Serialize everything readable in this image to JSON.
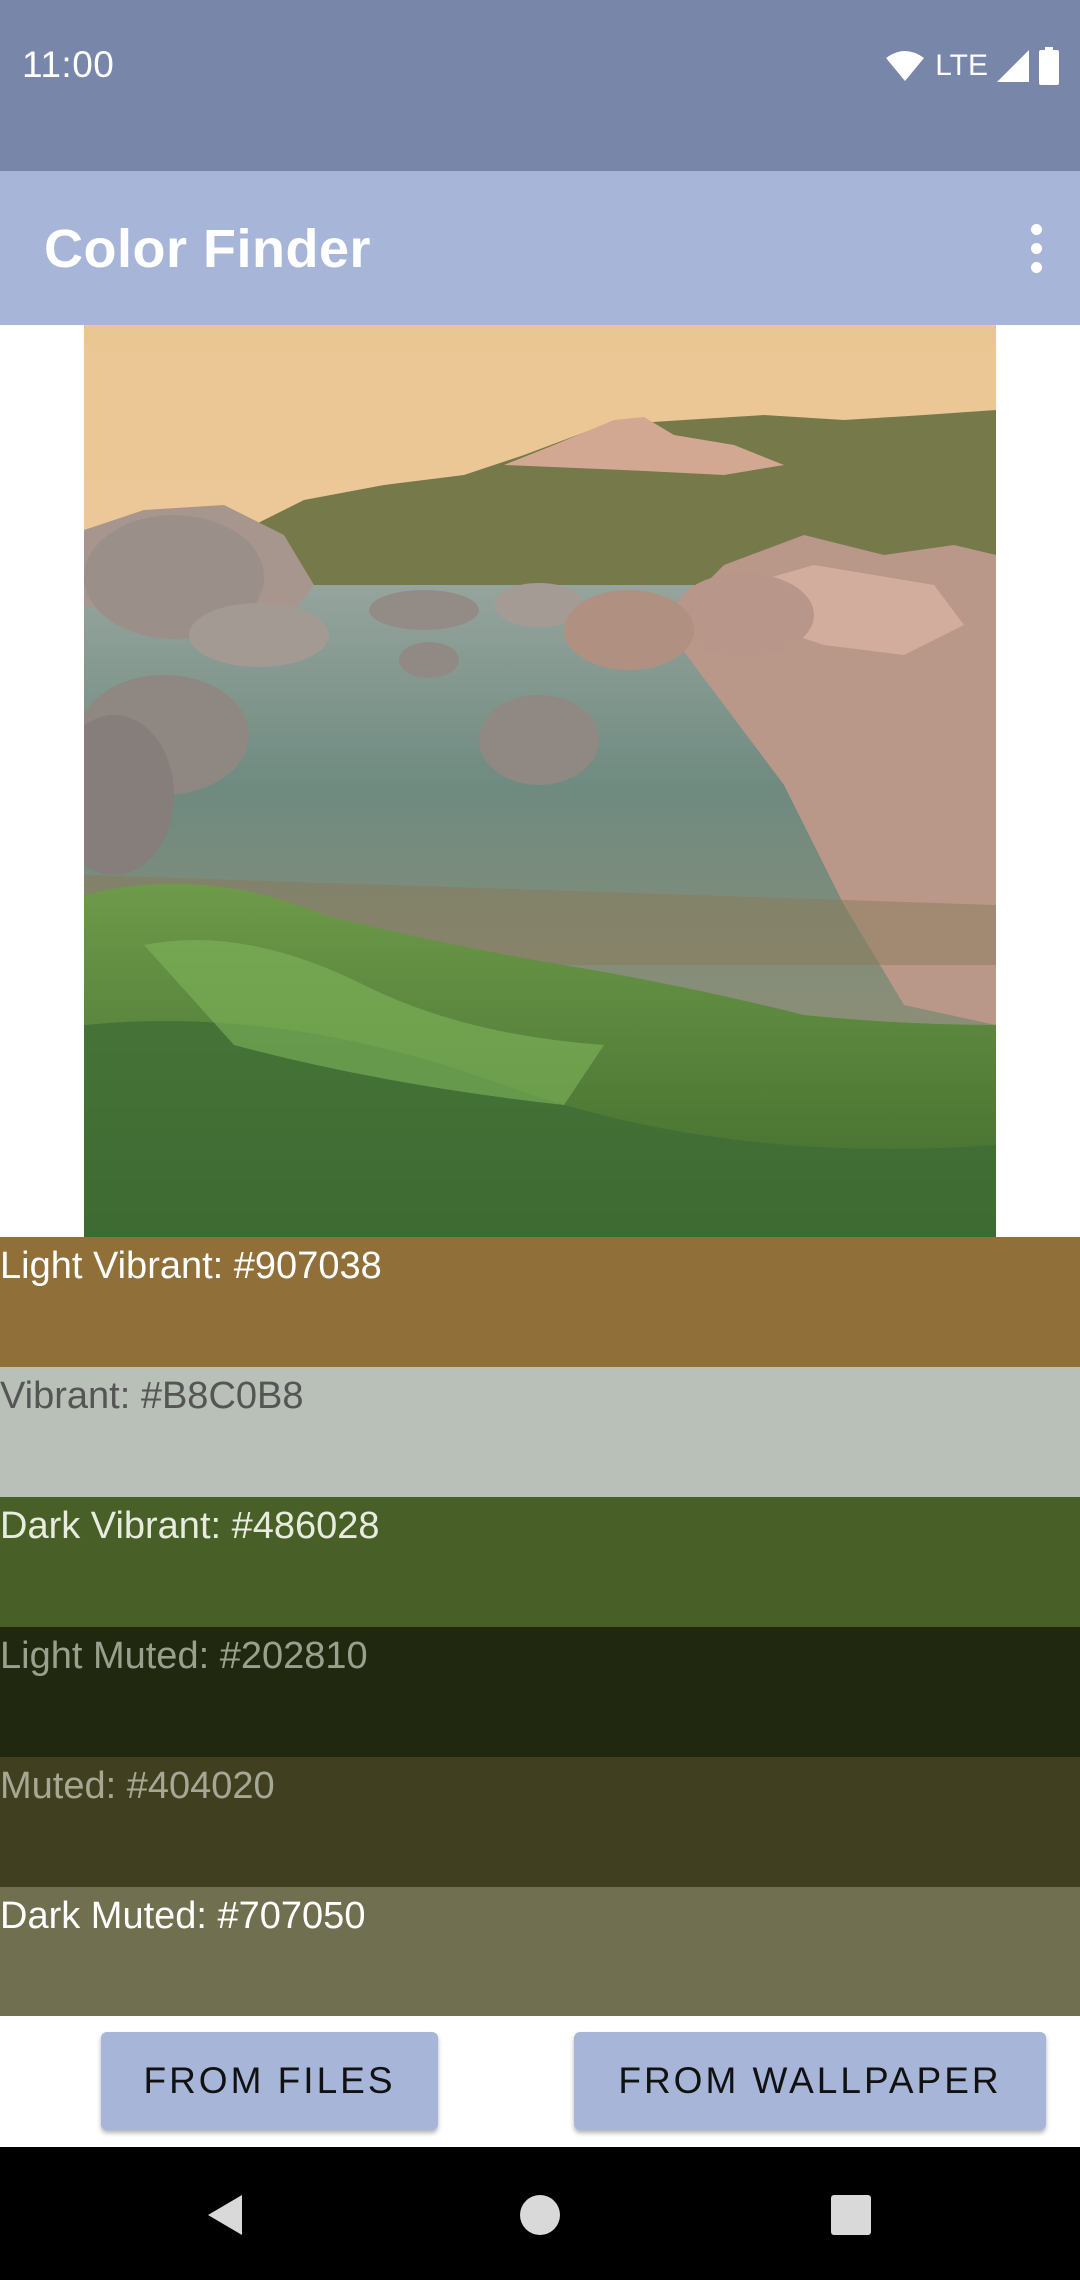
{
  "status_bar": {
    "time": "11:00",
    "network_label": "LTE",
    "icons": [
      "wifi-icon",
      "signal-icon",
      "battery-icon"
    ]
  },
  "app_bar": {
    "title": "Color Finder",
    "menu_icon": "more-vert-icon"
  },
  "palette": [
    {
      "label": "Light Vibrant: #907038",
      "color": "#907038",
      "text_color": "#ffffff"
    },
    {
      "label": "Vibrant: #B8C0B8",
      "color": "#B8C0B8",
      "text_color": "#555555"
    },
    {
      "label": "Dark Vibrant: #486028",
      "color": "#486028",
      "text_color": "#e8ecdf"
    },
    {
      "label": "Light Muted: #202810",
      "color": "#202810",
      "text_color": "#9aa08e"
    },
    {
      "label": "Muted: #404020",
      "color": "#404020",
      "text_color": "#a7a795"
    },
    {
      "label": "Dark Muted: #707050",
      "color": "#707050",
      "text_color": "#ffffff"
    }
  ],
  "buttons": {
    "from_files": "FROM FILES",
    "from_wallpaper": "FROM WALLPAPER"
  },
  "nav_bar": {
    "icons": [
      "back-icon",
      "home-icon",
      "recents-icon"
    ]
  },
  "colors": {
    "status_bar": "#7886a9",
    "app_bar": "#a6b5d8",
    "button": "#a6b5d8"
  }
}
